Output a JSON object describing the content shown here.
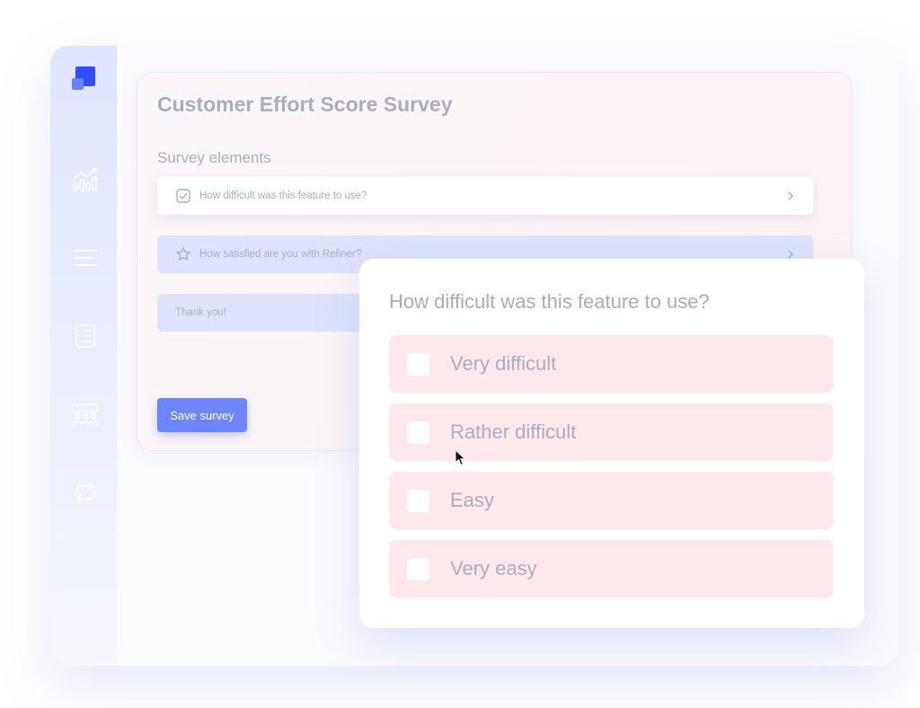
{
  "survey": {
    "title": "Customer Effort Score Survey",
    "section_label": "Survey elements",
    "elements": [
      {
        "label": "How difficult was this feature to use?",
        "icon": "checkbox-icon"
      },
      {
        "label": "How satisfied are you with Refiner?",
        "icon": "star-icon"
      },
      {
        "label": "Thank you!",
        "icon": ""
      }
    ],
    "save_label": "Save survey"
  },
  "popup": {
    "question": "How difficult was this feature to use?",
    "options": [
      "Very difficult",
      "Rather difficult",
      "Easy",
      "Very easy"
    ]
  },
  "sidebar": {
    "icons": [
      "chart-icon",
      "menu-icon",
      "list-icon",
      "users-icon",
      "sync-icon"
    ]
  },
  "colors": {
    "accent": "#2f4dff",
    "button": "#6d86ff",
    "option_bg": "#fde9ec",
    "sidebar_bg": "#dfe5fe"
  }
}
